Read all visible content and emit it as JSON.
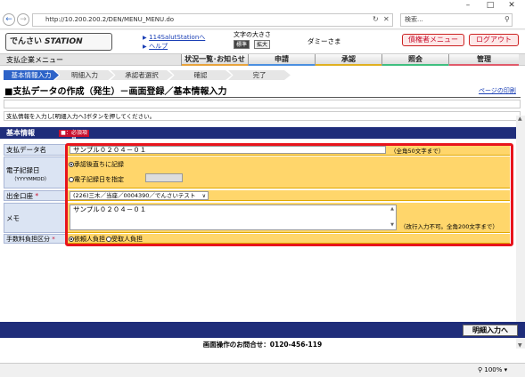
{
  "browser": {
    "url": "http://10.200.200.2/DEN/MENU_MENU.do",
    "search_placeholder": "検索...",
    "zoom": "100%"
  },
  "header": {
    "logo_chars": "でんさい",
    "logo_station": "STATION",
    "link_top": "114SalutStationへ",
    "link_help": "ヘルプ",
    "font_size_label": "文字の大きさ",
    "size_standard": "標準",
    "size_large": "拡大",
    "user_name": "ダミーさま",
    "manager_menu": "債権者メニュー",
    "logout": "ログアウト"
  },
  "menu": {
    "current": "支払企業メニュー",
    "tabs": [
      {
        "label": "状況一覧･お知らせ",
        "color": "#e8a33c"
      },
      {
        "label": "申請",
        "color": "#4a8fe0"
      },
      {
        "label": "承認",
        "color": "#e0b020"
      },
      {
        "label": "照会",
        "color": "#3fbf80"
      },
      {
        "label": "管理",
        "color": "#e05a6a"
      }
    ]
  },
  "steps": [
    "基本情報入力",
    "明細入力",
    "承認者選択",
    "確認",
    "完了"
  ],
  "page": {
    "title": "■支払データの作成（発生）－画面登録／基本情報入力",
    "print_link": "ページの印刷",
    "instruction": "支払情報を入力し[明細入力へ]ボタンを押してください。"
  },
  "form": {
    "section_title": "基本情報",
    "required_badge": "■：必須項目",
    "payment_name_label": "支払データ名",
    "payment_name_value": "サンプル０２０４－０１",
    "payment_name_note": "（全角50文字まで）",
    "record_date_label": "電子記録日",
    "record_date_sub": "（YYYYMMDD）",
    "record_option_now": "承認後直ちに記録",
    "record_option_date": "電子記録日を指定",
    "account_label": "出金口座",
    "account_value": "(226)三木／当座／0004390／でんさいテスト",
    "memo_label": "メモ",
    "memo_value": "サンプル０２０４－０１",
    "memo_note": "（改行入力不可。全角200文字まで）",
    "fee_label": "手数料負担区分",
    "fee_option_payer": "依頼人負担",
    "fee_option_receiver": "受取人負担"
  },
  "footer": {
    "next_button": "明細入力へ",
    "support": "画面操作のお問合せ：0120-456-119"
  }
}
